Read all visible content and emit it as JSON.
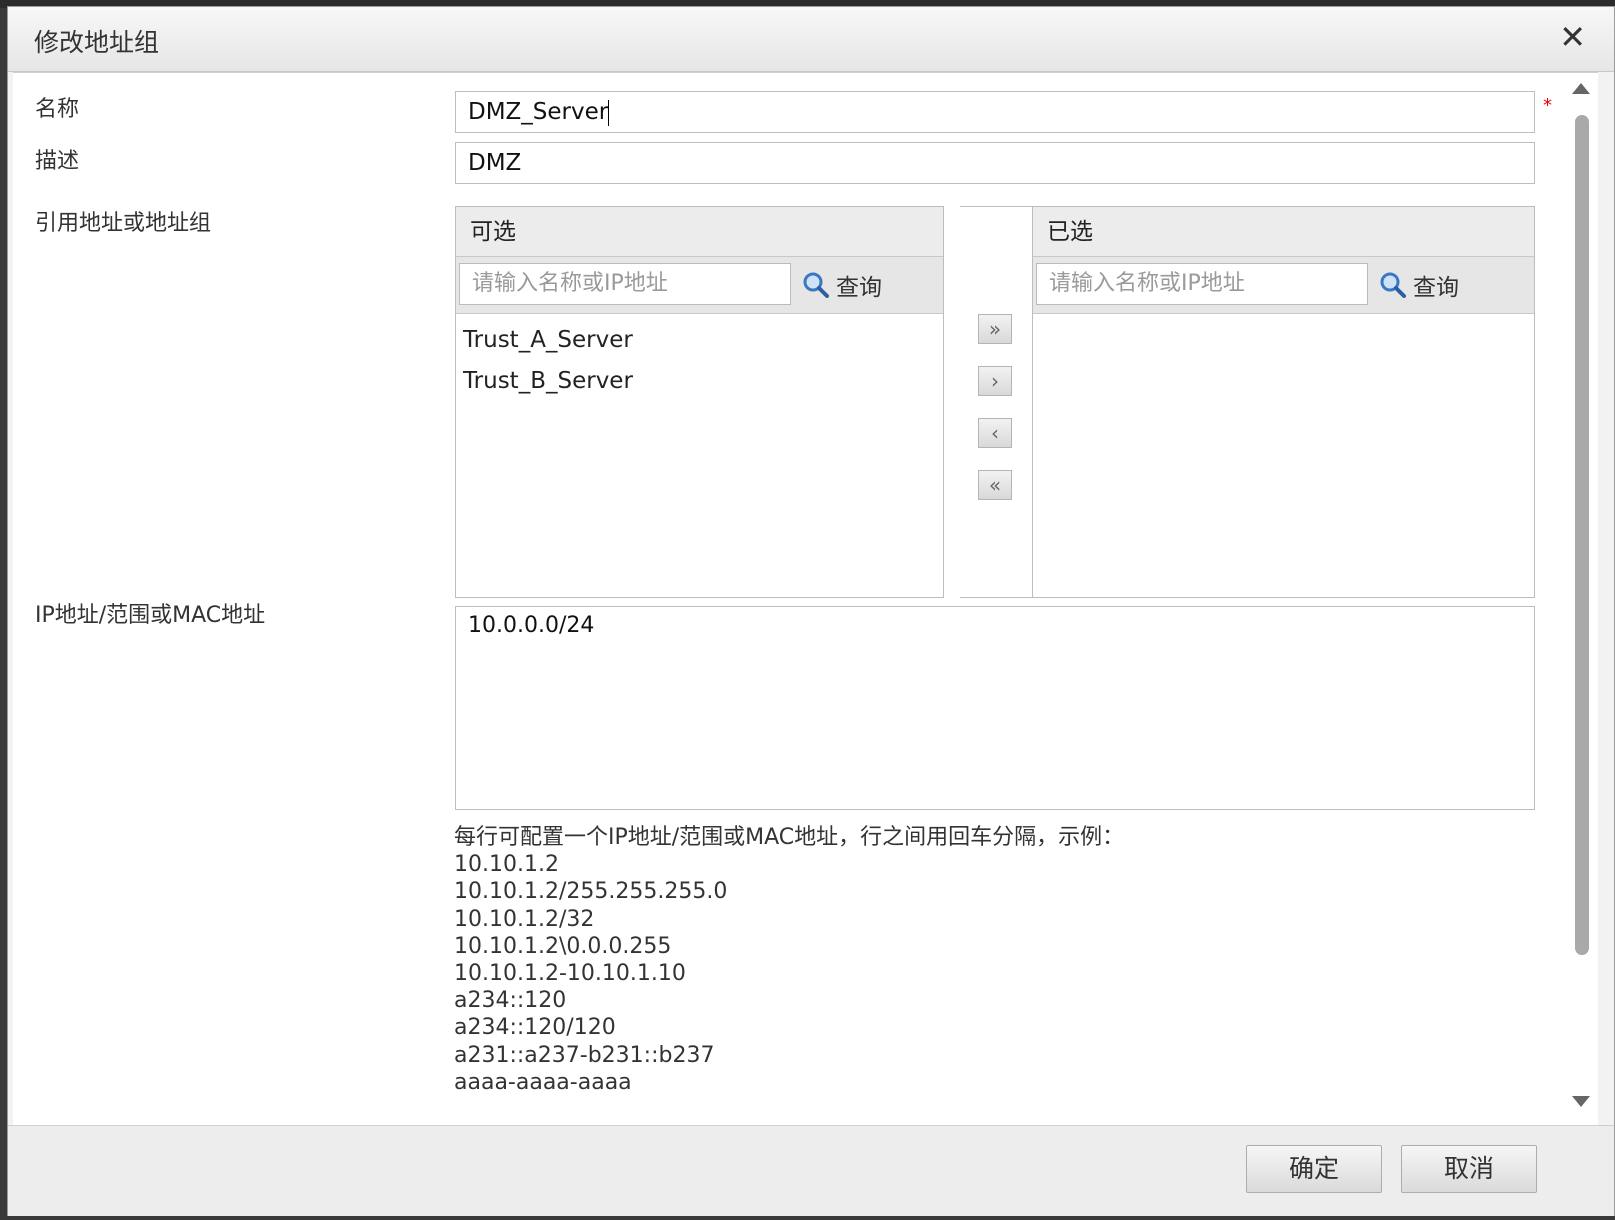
{
  "dialog": {
    "title": "修改地址组",
    "close_icon": "close-icon"
  },
  "form": {
    "name_label": "名称",
    "name_value": "DMZ_Server",
    "required_mark": "*",
    "desc_label": "描述",
    "desc_value": "DMZ",
    "ref_label": "引用地址或地址组",
    "ip_label": "IP地址/范围或MAC地址",
    "ip_value": "10.0.0.0/24"
  },
  "available": {
    "header": "可选",
    "search_placeholder": "请输入名称或IP地址",
    "search_label": "查询",
    "items": [
      "Trust_A_Server",
      "Trust_B_Server"
    ]
  },
  "selected": {
    "header": "已选",
    "search_placeholder": "请输入名称或IP地址",
    "search_label": "查询",
    "items": []
  },
  "transfer": {
    "add_all": "»",
    "add": "›",
    "remove": "‹",
    "remove_all": "«"
  },
  "hint": {
    "intro": "每行可配置一个IP地址/范围或MAC地址，行之间用回车分隔，示例：",
    "examples": [
      "10.10.1.2",
      "10.10.1.2/255.255.255.0",
      "10.10.1.2/32",
      "10.10.1.2\\0.0.0.255",
      "10.10.1.2-10.10.1.10",
      "a234::120",
      "a234::120/120",
      "a231::a237-b231::b237",
      "aaaa-aaaa-aaaa"
    ]
  },
  "footer": {
    "ok_label": "确定",
    "cancel_label": "取消"
  }
}
